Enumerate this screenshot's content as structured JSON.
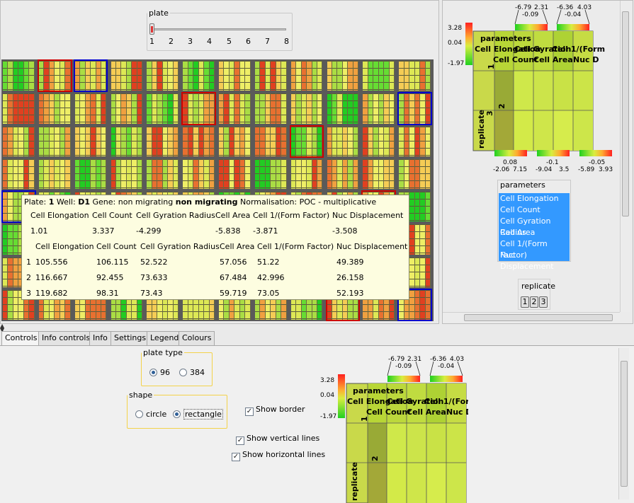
{
  "plate_slider": {
    "legend": "plate",
    "ticks": [
      "1",
      "2",
      "3",
      "4",
      "5",
      "6",
      "7",
      "8"
    ],
    "value": 1
  },
  "tooltip": {
    "plate_label": "Plate:",
    "plate": "1",
    "well_label": "Well:",
    "well": "D1",
    "gene_label": "Gene:",
    "gene1": "non migrating",
    "gene2": "non migrating",
    "normalisation": "Normalisation: POC - multiplicative",
    "summary_headers": [
      "Cell Elongation",
      "Cell Count",
      "Cell Gyration Radius",
      "Cell Area",
      "Cell 1/(Form Factor)",
      "Nuc Displacement"
    ],
    "summary_values": [
      "1.01",
      "3.337",
      "-4.299",
      "-5.838",
      "-3.871",
      "-3.508"
    ],
    "table_headers": [
      "Cell Elongation",
      "Cell Count",
      "Cell Gyration Radius",
      "Cell Area",
      "Cell 1/(Form Factor)",
      "Nuc Displacement"
    ],
    "rows": [
      [
        "1",
        "105.556",
        "106.115",
        "52.522",
        "57.056",
        "51.22",
        "49.389"
      ],
      [
        "2",
        "116.667",
        "92.455",
        "73.633",
        "67.484",
        "42.996",
        "26.158"
      ],
      [
        "3",
        "119.682",
        "98.31",
        "73.43",
        "59.719",
        "73.05",
        "52.193"
      ]
    ]
  },
  "legend_panel": {
    "colorbar": {
      "max": "3.28",
      "mid": "0.04",
      "min": "-1.97"
    },
    "top_scales": [
      {
        "lo": "-6.79",
        "hi": "2.31",
        "mid": "-0.09"
      },
      {
        "lo": "-6.36",
        "hi": "4.03",
        "mid": "-0.04"
      }
    ],
    "bottom_scales": [
      {
        "mid": "0.08",
        "lo": "-2.06",
        "hi": "7.15"
      },
      {
        "mid": "-0.1",
        "lo": "-9.04",
        "hi": "3.5"
      },
      {
        "mid": "-0.05",
        "lo": "-5.89",
        "hi": "3.93"
      }
    ],
    "matrix": {
      "parameters_title": "parameters",
      "row1": [
        "Cell Elongation",
        "Cell Gyration",
        "Cell 1/(Form"
      ],
      "row2": [
        "Cell Count",
        "Cell Area",
        "Nuc D"
      ],
      "side_1": "1",
      "side_2": "2",
      "replicate": "replicate",
      "side_3": "3"
    }
  },
  "parameters_list": {
    "title": "parameters",
    "items": [
      "Cell Elongation",
      "Cell Count",
      "Cell Gyration Radius",
      "Cell Area",
      "Cell 1/(Form Factor)",
      "Nuc Displacement"
    ]
  },
  "replicate_box": {
    "title": "replicate",
    "buttons": [
      "1",
      "2",
      "3"
    ]
  },
  "tabs": [
    "Controls",
    "Info controls",
    "Info",
    "Settings",
    "Legend",
    "Colours"
  ],
  "controls": {
    "plate_type": {
      "legend": "plate type",
      "options": [
        "96",
        "384"
      ],
      "selected": "96"
    },
    "shape": {
      "legend": "shape",
      "options": [
        "circle",
        "rectangle"
      ],
      "selected": "rectangle"
    },
    "checkboxes": {
      "show_border": "Show border",
      "show_vertical": "Show vertical lines",
      "show_horizontal": "Show horizontal lines"
    }
  },
  "colors": {
    "selected": "#3399ff",
    "well_border_red": "#cc0000",
    "well_border_blue": "#0000cc"
  }
}
